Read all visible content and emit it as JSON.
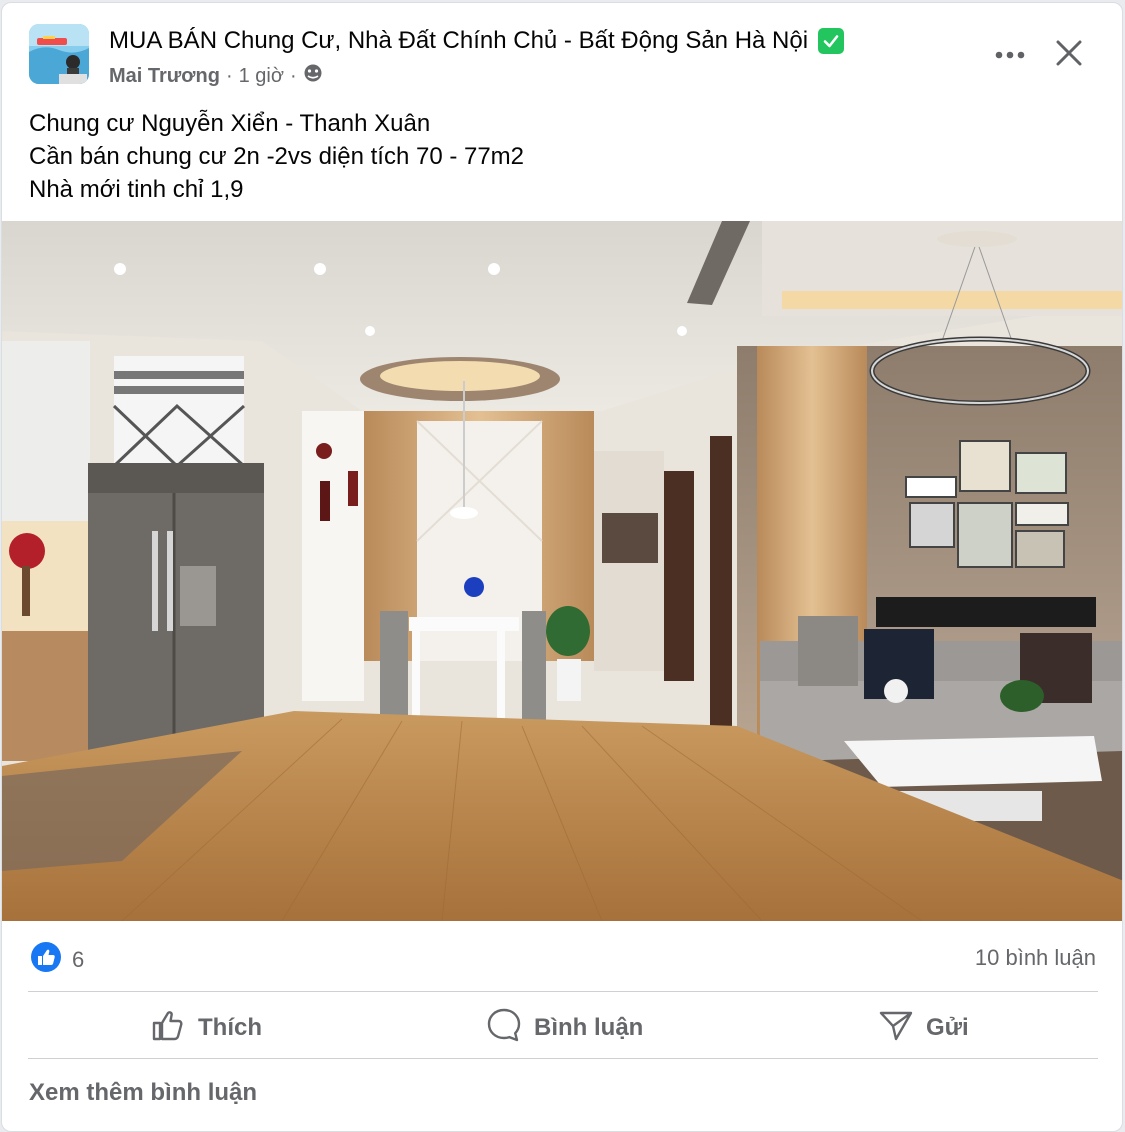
{
  "post": {
    "group_title": "MUA BÁN Chung Cư, Nhà Đất Chính Chủ - Bất Động Sản Hà Nội",
    "author": "Mai Trương",
    "time": "1 giờ",
    "separator": "·",
    "lines": [
      "Chung cư Nguyễn Xiển - Thanh Xuân",
      "Cần bán chung cư 2n -2vs diện tích 70 - 77m2",
      "Nhà mới tinh chỉ 1,9"
    ]
  },
  "stats": {
    "likes": "6",
    "comments": "10 bình luận"
  },
  "actions": {
    "like": "Thích",
    "comment": "Bình luận",
    "send": "Gửi"
  },
  "footer": {
    "more_comments": "Xem thêm bình luận"
  },
  "colors": {
    "like_blue": "#1877f2",
    "verified_green": "#22c55e",
    "secondary_text": "#65676b"
  },
  "icons": [
    "group-avatar",
    "verified-icon",
    "public-icon",
    "more-icon",
    "close-icon",
    "like-reaction-icon",
    "thumbs-up-icon",
    "comment-icon",
    "send-icon"
  ]
}
